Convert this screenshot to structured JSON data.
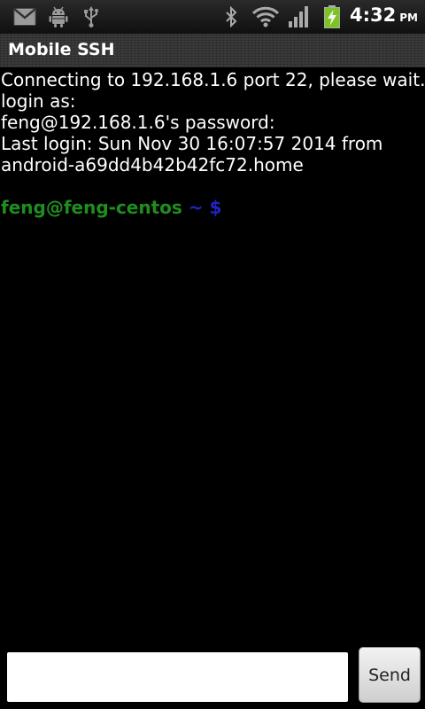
{
  "status_bar": {
    "notification_icons": [
      "gmail-icon",
      "android-debug-icon",
      "usb-icon"
    ],
    "system_icons": [
      "bluetooth-icon",
      "wifi-icon",
      "signal-icon",
      "battery-charging-icon"
    ],
    "time": "4:32",
    "ampm": "PM"
  },
  "app": {
    "title": "Mobile SSH"
  },
  "terminal": {
    "lines": [
      "Connecting to 192.168.1.6 port 22, please wait...",
      "login as:",
      "feng@192.168.1.6's password:",
      "Last login: Sun Nov 30 16:07:57 2014 from",
      "android-a69dd4b42b42fc72.home"
    ],
    "prompt": {
      "user_host": "feng@feng-centos",
      "path_symbol": " ~ $"
    },
    "colors": {
      "background": "#000000",
      "text": "#ffffff",
      "prompt_user": "#1e8e1e",
      "prompt_path": "#2222c8"
    }
  },
  "input": {
    "value": "",
    "placeholder": ""
  },
  "send_button": {
    "label": "Send"
  }
}
